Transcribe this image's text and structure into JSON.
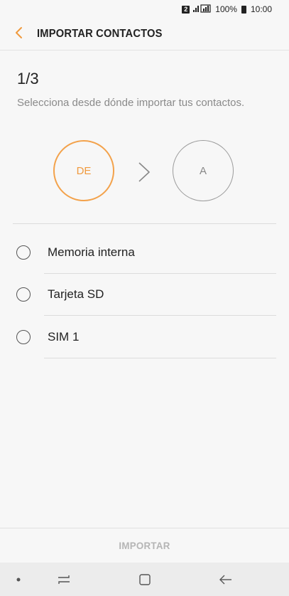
{
  "status_bar": {
    "sim_badge": "2",
    "battery": "100%",
    "time": "10:00"
  },
  "header": {
    "title": "IMPORTAR CONTACTOS"
  },
  "step": {
    "counter": "1/3",
    "instruction": "Selecciona desde dónde importar tus contactos."
  },
  "flow": {
    "from_label": "DE",
    "to_label": "A"
  },
  "options": [
    {
      "label": "Memoria interna",
      "selected": false
    },
    {
      "label": "Tarjeta SD",
      "selected": false
    },
    {
      "label": "SIM 1",
      "selected": false
    }
  ],
  "footer": {
    "import_label": "IMPORTAR"
  },
  "colors": {
    "accent": "#f09a3e",
    "inactive": "#9b9b9b",
    "disabled_text": "#b5b5b5"
  }
}
